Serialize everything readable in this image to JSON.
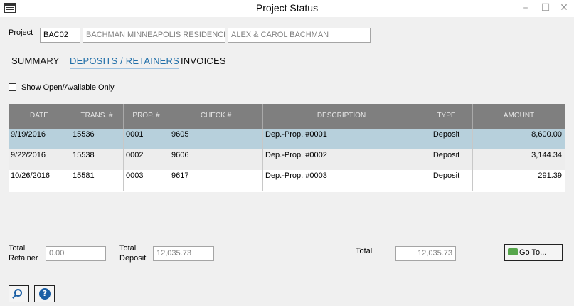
{
  "window": {
    "title": "Project Status",
    "min_icon": "–",
    "max_icon": "☐",
    "close_icon": "✕"
  },
  "project": {
    "label": "Project",
    "code": "BAC02",
    "name": "BACHMAN MINNEAPOLIS RESIDENCE",
    "client": "ALEX  & CAROL BACHMAN"
  },
  "tabs": [
    {
      "label": "SUMMARY"
    },
    {
      "label": "DEPOSITS / RETAINERS"
    },
    {
      "label": "INVOICES"
    }
  ],
  "filter": {
    "label": "Show Open/Available Only",
    "checked": false
  },
  "grid": {
    "headers": [
      "DATE",
      "TRANS. #",
      "PROP. #",
      "CHECK #",
      "DESCRIPTION",
      "TYPE",
      "AMOUNT"
    ],
    "rows": [
      {
        "date": "9/19/2016",
        "trans": "15536",
        "prop": "0001",
        "check": "9605",
        "desc": "Dep.-Prop. #0001",
        "type": "Deposit",
        "amount": "8,600.00"
      },
      {
        "date": "9/22/2016",
        "trans": "15538",
        "prop": "0002",
        "check": "9606",
        "desc": "Dep.-Prop. #0002",
        "type": "Deposit",
        "amount": "3,144.34"
      },
      {
        "date": "10/26/2016",
        "trans": "15581",
        "prop": "0003",
        "check": "9617",
        "desc": "Dep.-Prop. #0003",
        "type": "Deposit",
        "amount": "291.39"
      }
    ]
  },
  "totals": {
    "retainer_label_1": "Total",
    "retainer_label_2": "Retainer",
    "retainer_value": "0.00",
    "deposit_label_1": "Total",
    "deposit_label_2": "Deposit",
    "deposit_value": "12,035.73",
    "total_label": "Total",
    "total_value": "12,035.73"
  },
  "buttons": {
    "goto_label": "Go To...",
    "help_glyph": "?"
  },
  "colors": {
    "accent": "#1f6ea8",
    "header_bg": "#7f7f7f",
    "selected_row": "#b7d0dc"
  }
}
